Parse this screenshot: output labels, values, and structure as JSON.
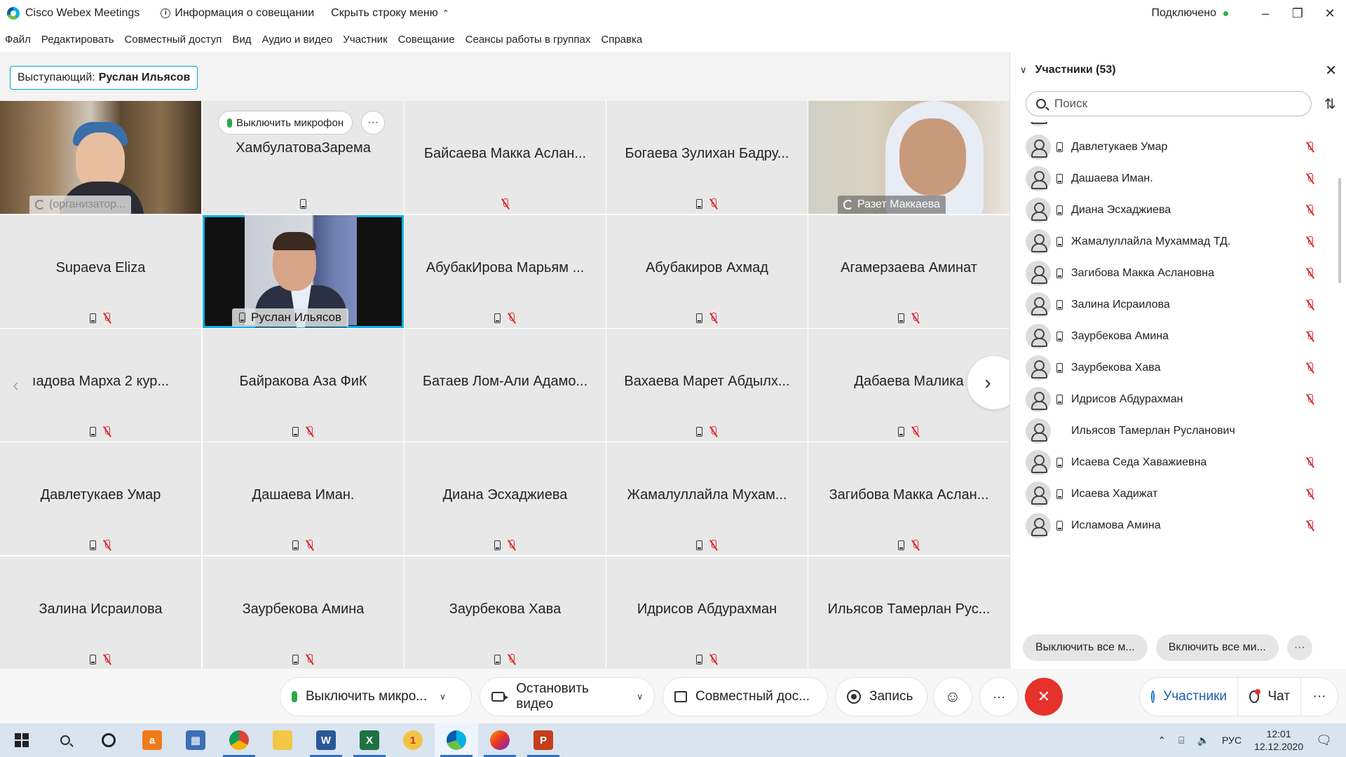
{
  "titlebar": {
    "app_title": "Cisco Webex Meetings",
    "meeting_info": "Информация о совещании",
    "hide_menu": "Скрыть строку меню",
    "status": "Подключено"
  },
  "menu": [
    "Файл",
    "Редактировать",
    "Совместный доступ",
    "Вид",
    "Аудио и видео",
    "Участник",
    "Совещание",
    "Сеансы работы в группах",
    "Справка"
  ],
  "speaker": {
    "label": "Выступающий:",
    "name": "Руслан Ильясов"
  },
  "tile_actions": {
    "mute_label": "Выключить микрофон",
    "more": "···"
  },
  "tiles": [
    {
      "name": "(организатор...",
      "video": "woman1"
    },
    {
      "name": "ХамбулатоваЗарема",
      "phone": true,
      "muted": false,
      "actions": true
    },
    {
      "name": "Байсаева Макка Аслан...",
      "phone": false,
      "muted": true
    },
    {
      "name": "Богаева Зулихан Бадру...",
      "phone": true,
      "muted": true
    },
    {
      "name": "Разет Маккаева",
      "video": "woman2"
    },
    {
      "name": "Supaeva Eliza",
      "phone": true,
      "muted": true
    },
    {
      "name": "Руслан Ильясов",
      "video": "man"
    },
    {
      "name": "АбубакИрова Марьям ...",
      "phone": true,
      "muted": true
    },
    {
      "name": "Абубакиров Ахмад",
      "phone": true,
      "muted": true
    },
    {
      "name": "Агамерзаева Аминат",
      "phone": true,
      "muted": true
    },
    {
      "name": "ıадова Марха 2 кур...",
      "phone": true,
      "muted": true
    },
    {
      "name": "Байракова Аза ФиК",
      "phone": true,
      "muted": true
    },
    {
      "name": "Батаев Лом-Али Адамо...",
      "phone": false,
      "muted": false
    },
    {
      "name": "Вахаева Марет Абдылх...",
      "phone": true,
      "muted": true
    },
    {
      "name": "Дабаева Малика",
      "phone": true,
      "muted": true
    },
    {
      "name": "Давлетукаев Умар",
      "phone": true,
      "muted": true
    },
    {
      "name": "Дашаева Иман.",
      "phone": true,
      "muted": true
    },
    {
      "name": "Диана Эсхаджиева",
      "phone": true,
      "muted": true
    },
    {
      "name": "Жамалуллайла Мухам...",
      "phone": true,
      "muted": true
    },
    {
      "name": "Загибова Макка Аслан...",
      "phone": true,
      "muted": true
    },
    {
      "name": "Залина Исраилова",
      "phone": true,
      "muted": true
    },
    {
      "name": "Заурбекова Амина",
      "phone": true,
      "muted": true
    },
    {
      "name": "Заурбекова Хава",
      "phone": true,
      "muted": true
    },
    {
      "name": "Идрисов Абдурахман",
      "phone": true,
      "muted": true
    },
    {
      "name": "Ильясов Тамерлан Рус...",
      "phone": false,
      "muted": false
    }
  ],
  "panel": {
    "title": "Участники (53)",
    "search_placeholder": "Поиск",
    "participants": [
      {
        "name": "Давлетукаев Умар",
        "phone": true,
        "muted": true
      },
      {
        "name": "Дашаева Иман.",
        "phone": true,
        "muted": true
      },
      {
        "name": "Диана Эсхаджиева",
        "phone": true,
        "muted": true
      },
      {
        "name": "Жамалуллайла Мухаммад ТД.",
        "phone": true,
        "muted": true
      },
      {
        "name": "Загибова Макка Аслановна",
        "phone": true,
        "muted": true
      },
      {
        "name": "Залина Исраилова",
        "phone": true,
        "muted": true
      },
      {
        "name": "Заурбекова Амина",
        "phone": true,
        "muted": true
      },
      {
        "name": "Заурбекова Хава",
        "phone": true,
        "muted": true
      },
      {
        "name": "Идрисов Абдурахман",
        "phone": true,
        "muted": true
      },
      {
        "name": "Ильясов Тамерлан Русланович",
        "phone": false,
        "muted": false
      },
      {
        "name": "Исаева Седа Хаважиевна",
        "phone": true,
        "muted": true
      },
      {
        "name": "Исаева Хадижат",
        "phone": true,
        "muted": true
      },
      {
        "name": "Исламова Амина",
        "phone": true,
        "muted": true
      }
    ],
    "mute_all": "Выключить все м...",
    "unmute_all": "Включить все ми..."
  },
  "controls": {
    "mute": "Выключить микро...",
    "video": "Остановить видео",
    "share": "Совместный дос...",
    "record": "Запись",
    "participants": "Участники",
    "chat": "Чат"
  },
  "taskbar": {
    "lang": "РУС",
    "time": "12:01",
    "date": "12.12.2020"
  },
  "colors": {
    "accent": "#00a0d1",
    "end": "#e5322b",
    "muted": "#e0262b",
    "connected": "#2ab34a"
  }
}
